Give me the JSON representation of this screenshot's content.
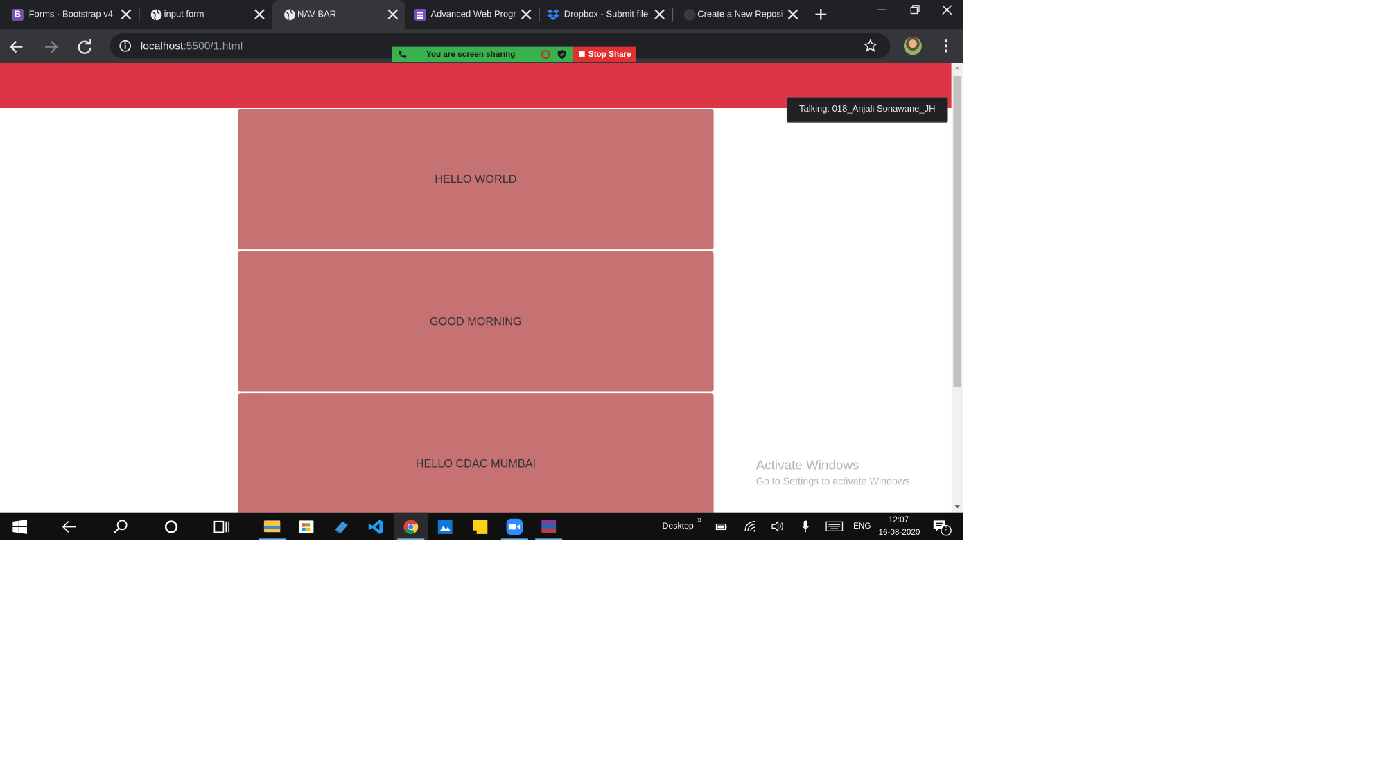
{
  "browser": {
    "tabs": [
      {
        "title": "Forms · Bootstrap v4.",
        "icon": "bootstrap-icon"
      },
      {
        "title": "input form",
        "icon": "globe-icon"
      },
      {
        "title": "NAV BAR",
        "icon": "globe-icon",
        "active": true
      },
      {
        "title": "Advanced Web Progr",
        "icon": "document-icon"
      },
      {
        "title": "Dropbox - Submit file",
        "icon": "dropbox-icon"
      },
      {
        "title": "Create a New Reposit",
        "icon": "github-icon"
      }
    ],
    "address": {
      "host": "localhost",
      "path": ":5500/1.html"
    }
  },
  "screen_share": {
    "message": "You are screen sharing",
    "stop_label": "Stop Share"
  },
  "page": {
    "cards": [
      "HELLO WORLD",
      "GOOD MORNING",
      "HELLO CDAC MUMBAI"
    ],
    "navbar_color": "#dc3545",
    "card_color": "#c67272"
  },
  "talking_indicator": "Talking: 018_Anjali Sonawane_JH",
  "watermark": {
    "title": "Activate Windows",
    "subtitle": "Go to Settings to activate Windows."
  },
  "taskbar": {
    "apps": [
      "file-explorer-icon",
      "store-icon",
      "unknown-app-icon",
      "vscode-icon",
      "chrome-icon",
      "photos-icon",
      "sticky-notes-icon",
      "zoom-icon",
      "winrar-icon"
    ],
    "desktop_label": "Desktop",
    "chevron": "»",
    "language": "ENG",
    "time": "12:07",
    "date": "16-08-2020",
    "notification_count": "2"
  }
}
